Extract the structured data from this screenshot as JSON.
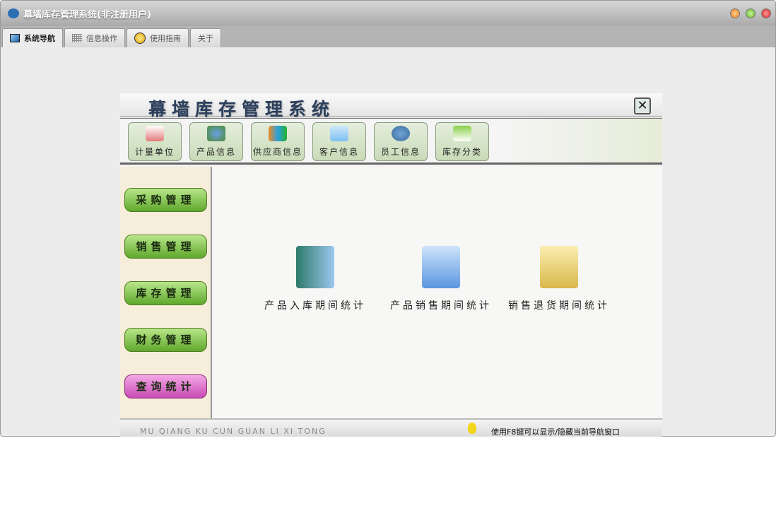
{
  "window": {
    "title": "幕墙库存管理系统(非注册用户)"
  },
  "tabs": [
    {
      "label": "系统导航",
      "active": true
    },
    {
      "label": "信息操作"
    },
    {
      "label": "使用指南"
    },
    {
      "label": "关于"
    }
  ],
  "panel": {
    "title": "幕墙库存管理系统",
    "toolbar": [
      {
        "label": "计量单位",
        "icon": "book-icon"
      },
      {
        "label": "产品信息",
        "icon": "products-icon"
      },
      {
        "label": "供应商信息",
        "icon": "supplier-icon"
      },
      {
        "label": "客户信息",
        "icon": "customer-icon"
      },
      {
        "label": "员工信息",
        "icon": "employee-icon"
      },
      {
        "label": "库存分类",
        "icon": "category-icon"
      }
    ],
    "side": [
      {
        "label": "采购管理"
      },
      {
        "label": "销售管理"
      },
      {
        "label": "库存管理"
      },
      {
        "label": "财务管理"
      },
      {
        "label": "查询统计",
        "active": true
      }
    ],
    "items": [
      {
        "label": "产品入库期间统计"
      },
      {
        "label": "产品销售期间统计"
      },
      {
        "label": "销售退货期间统计"
      }
    ],
    "footer": {
      "pinyin": "MU QIANG KU CUN  GUAN LI XI TONG",
      "hint": "使用F8键可以显示/隐藏当前导航窗口"
    }
  }
}
